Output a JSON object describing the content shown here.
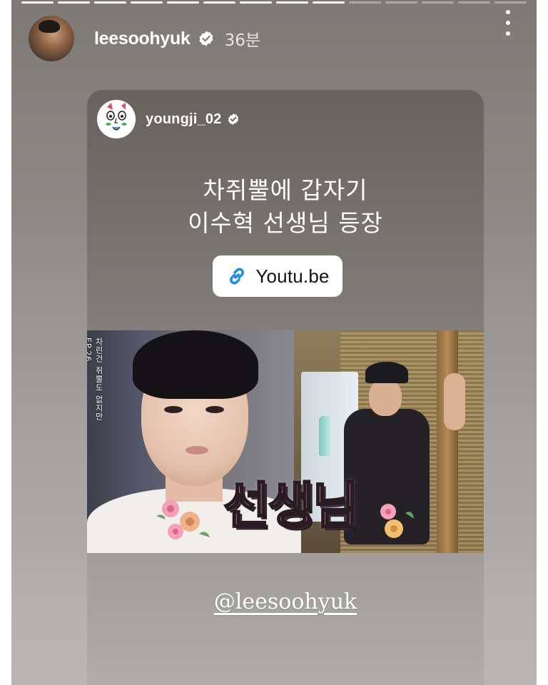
{
  "story": {
    "segments_total": 14,
    "segments_viewed": 9,
    "username": "leesoohyuk",
    "time_ago": "36분",
    "verified": true,
    "more_icon": "more-vertical-icon"
  },
  "shared_post": {
    "username": "youngji_02",
    "verified": true,
    "caption_line1": "차쥐뿔에 갑자기",
    "caption_line2": "이수혁 선생님 등장",
    "link_label": "Youtu.be",
    "link_icon": "link-icon",
    "thumbnail": {
      "side_text": "차린건 쥐뿔도 없지만 EP.26",
      "big_text": "선생님"
    }
  },
  "mention": "@leesoohyuk",
  "colors": {
    "link_icon": "#1f8fe0",
    "verified_badge": "#ffffff",
    "thumb_text_fill": "#f4a6b8"
  }
}
